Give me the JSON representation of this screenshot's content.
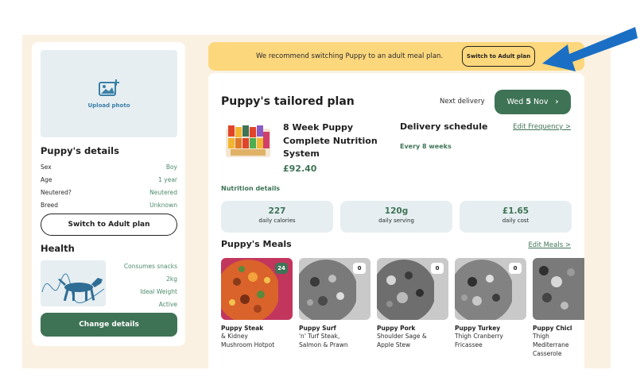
{
  "sidebar": {
    "upload_photo": "Upload photo",
    "details_title": "Puppy's details",
    "details": [
      {
        "key": "Sex",
        "value": "Boy"
      },
      {
        "key": "Age",
        "value": "1 year"
      },
      {
        "key": "Neutered?",
        "value": "Neutered"
      },
      {
        "key": "Breed",
        "value": "Unknown"
      }
    ],
    "switch_button": "Switch to Adult plan",
    "health_title": "Health",
    "health": [
      "Consumes snacks",
      "2kg",
      "Ideal Weight",
      "Active"
    ],
    "change_button": "Change details"
  },
  "banner": {
    "message": "We recommend switching Puppy to an adult meal plan.",
    "button": "Switch to Adult plan"
  },
  "plan": {
    "title": "Puppy's tailored plan",
    "next_delivery_label": "Next delivery",
    "delivery_day": "Wed",
    "delivery_date": "5",
    "delivery_month": "Nov",
    "product_name": "8 Week Puppy Complete Nutrition System",
    "price": "£92.40",
    "schedule_title": "Delivery schedule",
    "edit_frequency": "Edit Frequency >",
    "schedule_value": "Every 8 weeks",
    "nutrition_label": "Nutrition details",
    "stats": [
      {
        "value": "227",
        "label": "daily calories"
      },
      {
        "value": "120g",
        "label": "daily serving"
      },
      {
        "value": "£1.65",
        "label": "daily cost"
      }
    ],
    "meals_title": "Puppy's Meals",
    "edit_meals": "Edit Meals >",
    "meals": [
      {
        "name": "Puppy Steak",
        "desc1": "& Kidney",
        "desc2": "Mushroom Hotpot",
        "desc3": "",
        "count": "24"
      },
      {
        "name": "Puppy Surf",
        "desc1": "'n' Turf Steak,",
        "desc2": "Salmon & Prawn",
        "desc3": "",
        "count": "0"
      },
      {
        "name": "Puppy Pork",
        "desc1": "Shoulder Sage &",
        "desc2": "Apple Stew",
        "desc3": "",
        "count": "0"
      },
      {
        "name": "Puppy Turkey",
        "desc1": "Thigh Cranberry",
        "desc2": "Fricassee",
        "desc3": "",
        "count": "0"
      },
      {
        "name": "Puppy Chicl",
        "desc1": "Thigh",
        "desc2": "Mediterrane",
        "desc3": "Casserole",
        "count": ""
      }
    ]
  },
  "colors": {
    "brand_green": "#3f7356",
    "banner_yellow": "#fcd77c",
    "arrow_blue": "#1a6fc4"
  },
  "icons": {
    "upload": "photo-upload-icon",
    "chevron": "chevron-right-icon",
    "arrow": "pointer-arrow-icon"
  }
}
